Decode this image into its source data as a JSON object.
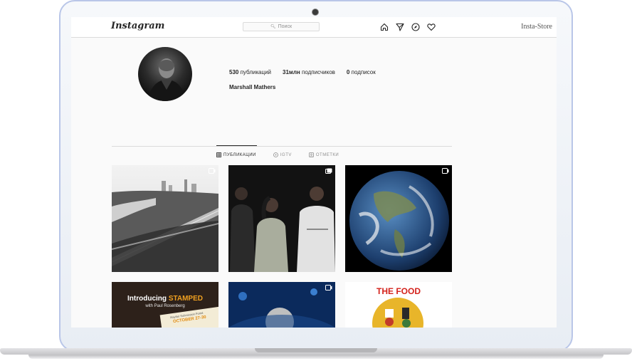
{
  "app": {
    "logo": "Instagram",
    "search_placeholder": "Поиск",
    "store_label": "Insta-Store"
  },
  "nav": {
    "icons": [
      "home-icon",
      "direct-icon",
      "explore-icon",
      "heart-icon"
    ]
  },
  "profile": {
    "posts_count": "530",
    "posts_label": "публикаций",
    "followers_count": "31млн",
    "followers_label": "подписчиков",
    "following_count": "0",
    "following_label": "подписок",
    "name": "Marshall Mathers"
  },
  "tabs": [
    {
      "label": "ПУБЛИКАЦИИ",
      "icon": "grid-icon",
      "active": true
    },
    {
      "label": "IGTV",
      "icon": "igtv-icon",
      "active": false
    },
    {
      "label": "ОТМЕТКИ",
      "icon": "tag-icon",
      "active": false
    }
  ],
  "posts": {
    "p5_line1": "Introducing",
    "p5_line2": "STAMPED",
    "p5_line3": "with Paul Rosenberg",
    "p5_line4": "Mayfair Submission Portal",
    "p5_line5": "OCTOBER 27-30",
    "p6_title": "THE FOOD"
  }
}
